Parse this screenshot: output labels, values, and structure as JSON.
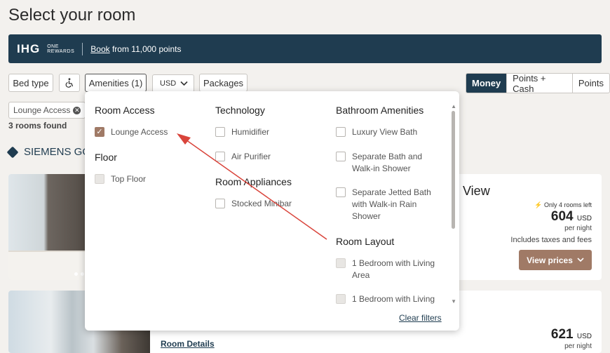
{
  "page": {
    "title": "Select your room"
  },
  "banner": {
    "brand": "IHG",
    "program_line1": "ONE",
    "program_line2": "REWARDS",
    "book_link": "Book",
    "text": " from 11,000 points"
  },
  "filters": {
    "bed_type": "Bed type",
    "accessibility_icon": "wheelchair-icon",
    "amenities": "Amenities (1)",
    "currency": "USD",
    "packages": "Packages",
    "payment_modes": [
      "Money",
      "Points + Cash",
      "Points"
    ],
    "active_chip": "Lounge Access",
    "rooms_found": "3 rooms found"
  },
  "hotel": {
    "name": "SIEMENS GO"
  },
  "cards": [
    {
      "name_fragment": "View",
      "rooms_left": "Only 4 rooms left",
      "price": "604",
      "currency": "USD",
      "per": "per night",
      "taxes": "Includes taxes and fees",
      "cta": "View prices"
    },
    {
      "price": "621",
      "currency": "USD",
      "per": "per night",
      "details_link": "Room Details"
    }
  ],
  "dropdown": {
    "room_access": {
      "heading": "Room Access",
      "options": [
        {
          "label": "Lounge Access",
          "checked": true
        }
      ]
    },
    "floor": {
      "heading": "Floor",
      "options": [
        {
          "label": "Top Floor",
          "checked": false
        }
      ]
    },
    "technology": {
      "heading": "Technology",
      "options": [
        {
          "label": "Humidifier",
          "checked": false
        },
        {
          "label": "Air Purifier",
          "checked": false
        }
      ]
    },
    "room_appliances": {
      "heading": "Room Appliances",
      "options": [
        {
          "label": "Stocked Minibar",
          "checked": false
        }
      ]
    },
    "bathroom": {
      "heading": "Bathroom Amenities",
      "options": [
        {
          "label": "Luxury View Bath",
          "checked": false
        },
        {
          "label": "Separate Bath and Walk-in Shower",
          "checked": false
        },
        {
          "label": "Separate Jetted Bath with Walk-in Rain Shower",
          "checked": false
        }
      ]
    },
    "room_layout": {
      "heading": "Room Layout",
      "options": [
        {
          "label": "1 Bedroom with Living Area",
          "checked": false
        },
        {
          "label": "1 Bedroom with Living",
          "checked": false
        }
      ]
    },
    "clear": "Clear filters"
  },
  "colors": {
    "navy": "#1f3c50",
    "accent": "#a07a66",
    "arrow": "#d9443b"
  }
}
